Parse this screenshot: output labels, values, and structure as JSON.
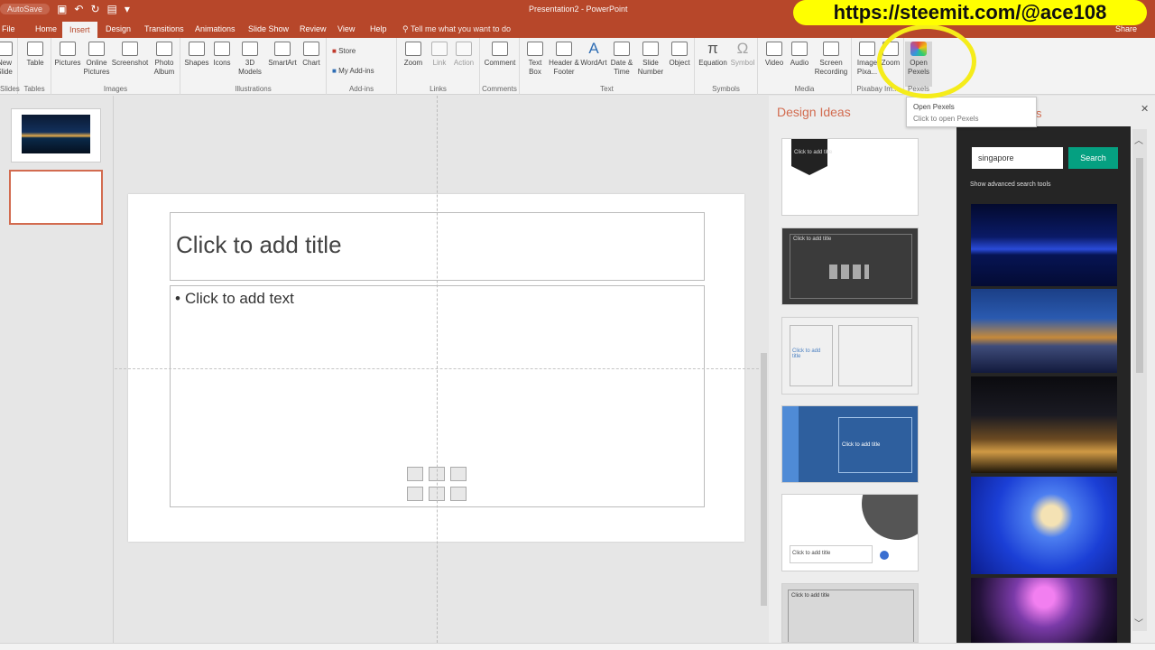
{
  "titlebar": {
    "autosave": "AutoSave",
    "document_title": "Presentation2 - PowerPoint"
  },
  "tabs": [
    "File",
    "Home",
    "Insert",
    "Design",
    "Transitions",
    "Animations",
    "Slide Show",
    "Review",
    "View",
    "Help"
  ],
  "tell_me": "Tell me what you want to do",
  "share": "Share",
  "ribbon": {
    "slides_group": "Slides",
    "new_slide": "New Slide",
    "tables_group": "Tables",
    "table": "Table",
    "images_group": "Images",
    "pictures": "Pictures",
    "online_pictures": "Online Pictures",
    "screenshot": "Screenshot",
    "photo_album": "Photo Album",
    "illustrations_group": "Illustrations",
    "shapes": "Shapes",
    "icons": "Icons",
    "models_3d": "3D Models",
    "smartart": "SmartArt",
    "chart": "Chart",
    "addins_group": "Add-ins",
    "store": "Store",
    "my_addins": "My Add-ins",
    "links_group": "Links",
    "zoom": "Zoom",
    "link": "Link",
    "action": "Action",
    "comments_group": "Comments",
    "comment": "Comment",
    "text_group": "Text",
    "text_box": "Text Box",
    "header_footer": "Header & Footer",
    "wordart": "WordArt",
    "date_time": "Date & Time",
    "slide_number": "Slide Number",
    "object": "Object",
    "symbols_group": "Symbols",
    "equation": "Equation",
    "symbol": "Symbol",
    "media_group": "Media",
    "video": "Video",
    "audio": "Audio",
    "screen_recording": "Screen Recording",
    "pixabay_group": "Pixabay Im...",
    "image_pixabay": "Image Pixa...",
    "zoom2": "Zoom",
    "pexels_group": "Pexels",
    "open_pexels": "Open Pexels"
  },
  "tooltip": {
    "title": "Open Pexels",
    "desc": "Click to open Pexels"
  },
  "watermark": "https://steemit.com/@ace108",
  "slide": {
    "title_placeholder": "Click to add title",
    "body_placeholder": "Click to add text"
  },
  "design_ideas": {
    "title": "Design Ideas",
    "items": [
      "Click to add title",
      "Click to add title",
      "Click to add title",
      "Click to add title",
      "Click to add title",
      "Click to add title"
    ]
  },
  "pexels": {
    "tab_letter": "s",
    "search_value": "singapore",
    "search_button": "Search",
    "advanced_link": "Show advanced search tools"
  }
}
